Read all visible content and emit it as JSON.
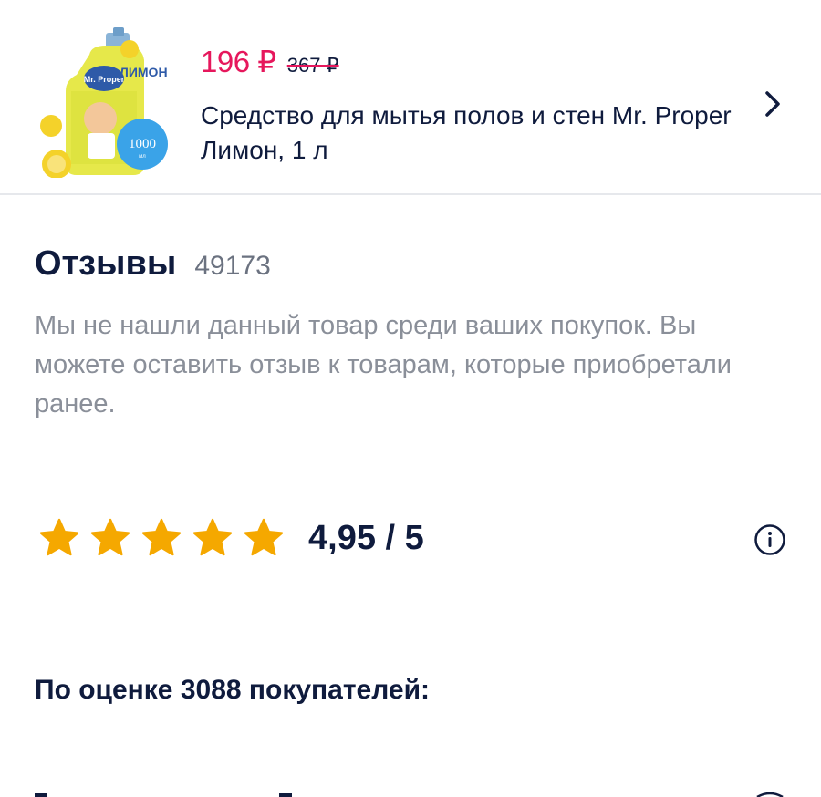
{
  "product": {
    "image_badge": "1000",
    "image_badge_unit": "мл",
    "image_label": "ЛИМОН",
    "price_current": "196 ₽",
    "price_old": "367 ₽",
    "title": "Средство для мытья полов и стен Mr. Proper Лимон, 1 л"
  },
  "reviews": {
    "title": "Отзывы",
    "count": "49173",
    "note": "Мы не нашли данный товар среди ваших покупок. Вы можете оставить отзыв к товарам, которые приобретали ранее.",
    "rating": "4,95 / 5",
    "rating_value": 4.95,
    "rating_max": 5,
    "rated_by": "По оценке 3088 покупателей:"
  },
  "colors": {
    "price": "#e6175c",
    "star": "#f5a800",
    "text": "#0f1b3d",
    "muted": "#8a8f99"
  }
}
